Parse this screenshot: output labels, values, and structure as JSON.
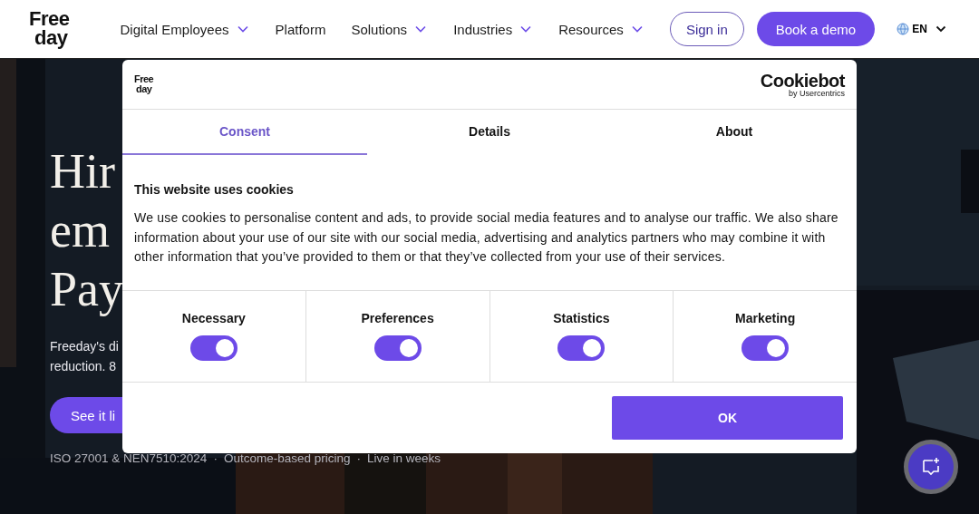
{
  "header": {
    "logo_lines": [
      "Free",
      "day"
    ],
    "nav": [
      {
        "label": "Digital Employees",
        "dropdown": true
      },
      {
        "label": "Platform",
        "dropdown": false
      },
      {
        "label": "Solutions",
        "dropdown": true
      },
      {
        "label": "Industries",
        "dropdown": true
      },
      {
        "label": "Resources",
        "dropdown": true
      }
    ],
    "sign_in": "Sign in",
    "book_demo": "Book a demo",
    "language": "EN"
  },
  "hero": {
    "headline_lines": [
      "Hir",
      "em",
      "Pay"
    ],
    "paragraph_lines": [
      "Freeday's di",
      "reduction. 8"
    ],
    "cta": "See it li",
    "separator": "·",
    "highlights": [
      "ISO 27001 & NEN7510:2024",
      "Outcome-based pricing",
      "Live in weeks"
    ]
  },
  "cookie_dialog": {
    "logo_lines": [
      "Free",
      "day"
    ],
    "brand": "Cookiebot",
    "brand_sub": "by Usercentrics",
    "tabs": [
      {
        "label": "Consent",
        "selected": true
      },
      {
        "label": "Details",
        "selected": false
      },
      {
        "label": "About",
        "selected": false
      }
    ],
    "heading": "This website uses cookies",
    "body": "We use cookies to personalise content and ads, to provide social media features and to analyse our traffic. We also share information about your use of our site with our social media, advertising and analytics partners who may combine it with other information that you’ve provided to them or that they’ve collected from your use of their services.",
    "categories": [
      {
        "label": "Necessary",
        "on": true
      },
      {
        "label": "Preferences",
        "on": true
      },
      {
        "label": "Statistics",
        "on": true
      },
      {
        "label": "Marketing",
        "on": true
      }
    ],
    "ok": "OK"
  }
}
